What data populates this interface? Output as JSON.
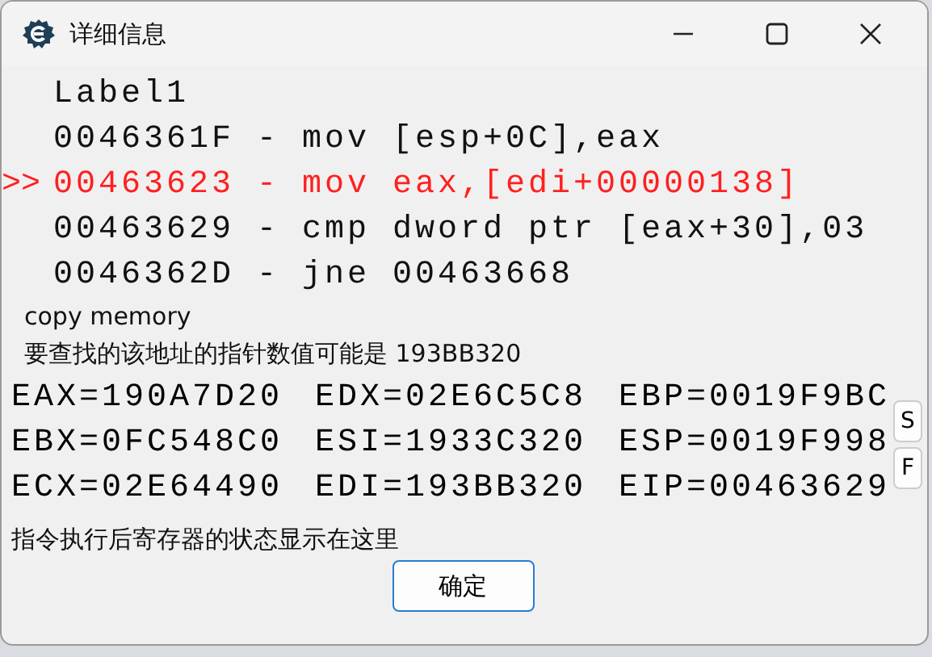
{
  "window": {
    "title": "详细信息"
  },
  "code_lines": [
    {
      "text": "Label1",
      "current": false
    },
    {
      "text": "0046361F - mov [esp+0C],eax",
      "current": false
    },
    {
      "prefix": ">>",
      "text": "00463623 - mov eax,[edi+00000138]",
      "current": true
    },
    {
      "text": "00463629 - cmp dword ptr [eax+30],03",
      "current": false
    },
    {
      "text": "0046362D - jne 00463668",
      "current": false
    }
  ],
  "info_lines": [
    "copy memory",
    "要查找的该地址的指针数值可能是 193BB320"
  ],
  "registers": [
    [
      "EAX=190A7D20",
      "EDX=02E6C5C8",
      "EBP=0019F9BC"
    ],
    [
      "EBX=0FC548C0",
      "ESI=1933C320",
      "ESP=0019F998"
    ],
    [
      "ECX=02E64490",
      "EDI=193BB320",
      "EIP=00463629"
    ]
  ],
  "side_buttons": [
    "S",
    "F"
  ],
  "status": "指令执行后寄存器的状态显示在这里",
  "buttons": [
    "确定"
  ]
}
